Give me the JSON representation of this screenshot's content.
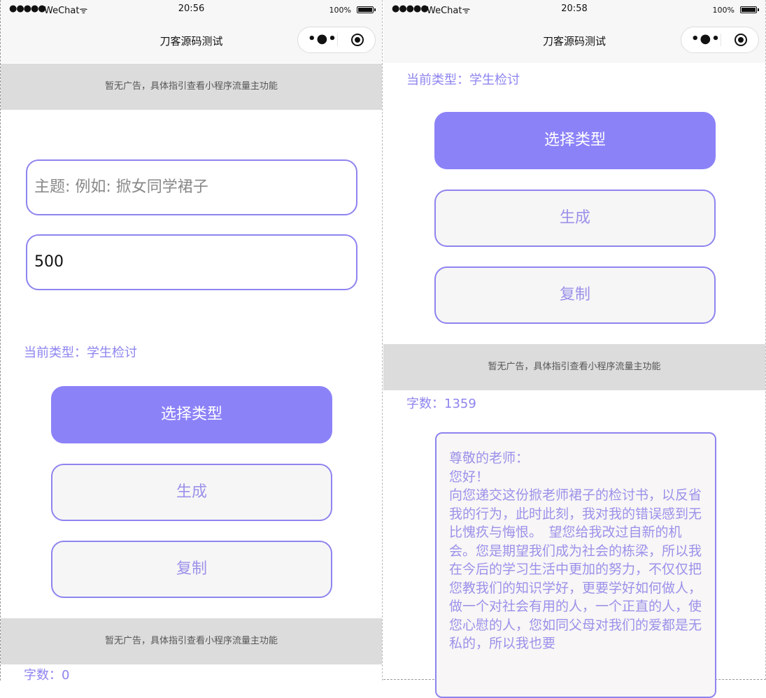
{
  "screens": [
    {
      "status": {
        "signal": "●●●●●",
        "carrier": "WeChat",
        "wifi": "ᯤ",
        "time": "20:56",
        "battery": "100%"
      },
      "nav": {
        "title": "刀客源码测试",
        "more": "•●•"
      },
      "ad_top": "暂无广告，具体指引查看小程序流量主功能",
      "topic_input": {
        "placeholder": "主题: 例如: 掀女同学裙子",
        "value": ""
      },
      "count_input": {
        "value": "500"
      },
      "current_type": "当前类型：学生检讨",
      "buttons": {
        "select_type": "选择类型",
        "generate": "生成",
        "copy": "复制"
      },
      "ad_bottom": "暂无广告，具体指引查看小程序流量主功能",
      "word_count": "字数：0"
    },
    {
      "status": {
        "signal": "●●●●●",
        "carrier": "WeChat",
        "wifi": "ᯤ",
        "time": "20:58",
        "battery": "100%"
      },
      "nav": {
        "title": "刀客源码测试",
        "more": "•●•"
      },
      "current_type": "当前类型：学生检讨",
      "buttons": {
        "select_type": "选择类型",
        "generate": "生成",
        "copy": "复制"
      },
      "ad": "暂无广告，具体指引查看小程序流量主功能",
      "word_count": "字数：1359",
      "essay": "尊敬的老师：\n您好！\n向您递交这份掀老师裙子的检讨书，以反省我的行为，此时此刻，我对我的错误感到无比愧疚与悔恨。　望您给我改过自新的机会。您是期望我们成为社会的栋梁，所以我在今后的学习生活中更加的努力，不仅仅把您教我们的知识学好，更要学好如何做人，做一个对社会有用的人，一个正直的人，使您心慰的人，您如同父母对我们的爱都是无私的，所以我也要"
    }
  ],
  "colors": {
    "accent": "#8e84ef",
    "primary_button": "#8c82f8",
    "ad_bg": "#dcdcdc",
    "nav_bg": "#f7f7f7"
  }
}
